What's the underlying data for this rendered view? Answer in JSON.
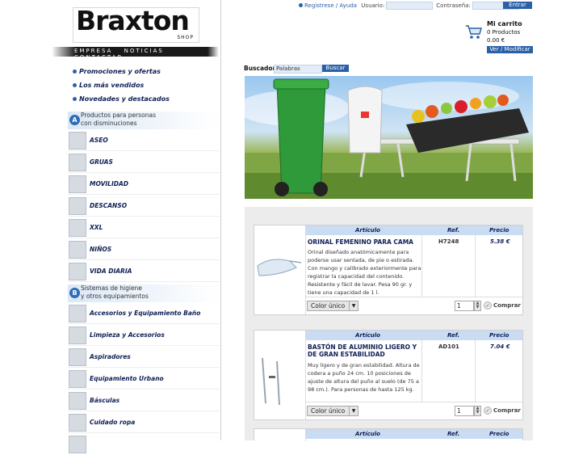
{
  "brand": {
    "name": "Braxton",
    "tagline": "SHOP"
  },
  "top_nav": [
    "EMPRESA",
    "NOTICIAS",
    "CONTACTAR"
  ],
  "promos": [
    "Promociones y ofertas",
    "Los más vendidos",
    "Novedades y destacados"
  ],
  "section_a": {
    "badge": "A",
    "line1": "Productos para personas",
    "line2": "con disminuciones"
  },
  "categories_a": [
    "ASEO",
    "GRUAS",
    "MOVILIDAD",
    "DESCANSO",
    "XXL",
    "NIÑOS",
    "VIDA DIARIA"
  ],
  "section_b": {
    "badge": "B",
    "line1": "Sistemas de higiene",
    "line2": "y otros equipamientos"
  },
  "categories_b": [
    "Accesorios y Equipamiento Baño",
    "Limpieza y Accesorios",
    "Aspiradores",
    "Equipamiento Urbano",
    "Básculas",
    "Cuidado ropa"
  ],
  "login": {
    "register_link": "Registrese / Ayuda",
    "user_label": "Usuario:",
    "password_label": "Contraseña:",
    "button": "Entrar"
  },
  "cart": {
    "title": "Mi carrito",
    "count": "0 Productos",
    "total": "0.00 €",
    "button": "Ver / Modificar"
  },
  "search": {
    "label": "Buscador:",
    "placeholder": "Palabras",
    "button": "Buscar"
  },
  "table_headers": {
    "article": "Artículo",
    "ref": "Ref.",
    "price": "Precio"
  },
  "products": [
    {
      "title": "ORINAL FEMENINO PARA CAMA",
      "description": "Orinal diseñado anatómicamente para poderse usar sentada, de pie o estirada. Con mango y calibrado exteriormente para registrar la capacidad del contenido. Resistente y fácil de lavar. Pesa 90 gr. y tiene una capacidad de 1 l.",
      "ref": "H7248",
      "price": "5.38 €",
      "option": "Color único",
      "qty": "1",
      "buy": "Comprar"
    },
    {
      "title": "BASTÓN DE ALUMINIO LIGERO Y DE GRAN ESTABILIDAD",
      "description": "Muy ligero y de gran estabilidad. Altura de codera a puño 24 cm. 10 posiciones de ajuste de altura del puño al suelo (de 75 a 98 cm.). Para personas de hasta 125 kg.",
      "ref": "AD101",
      "price": "7.04 €",
      "option": "Color único",
      "qty": "1",
      "buy": "Comprar"
    }
  ]
}
